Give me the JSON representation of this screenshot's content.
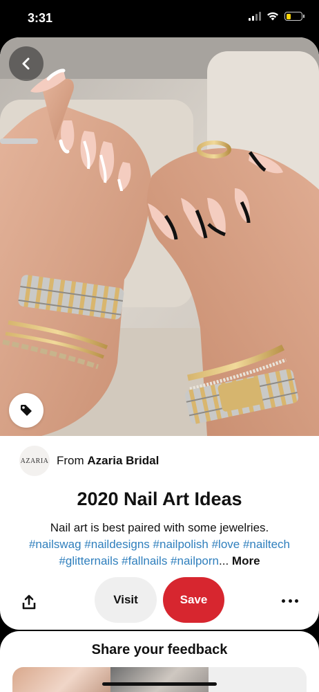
{
  "status": {
    "time": "3:31"
  },
  "pin": {
    "source_avatar_text": "AZARIA",
    "source_prefix": "From",
    "source_name": "Azaria Bridal",
    "title": "2020 Nail Art Ideas",
    "description_text": "Nail art is best paired with some jewelries.",
    "hashtags_line1": "#nailswag #naildesigns #nailpolish #love #nailtech",
    "hashtags_line2": "#glitternails #fallnails #nailporn",
    "ellipsis": "...",
    "more_label": "More"
  },
  "actions": {
    "visit_label": "Visit",
    "save_label": "Save"
  },
  "feedback": {
    "title": "Share your feedback"
  },
  "colors": {
    "save": "#d7262f",
    "hashtag": "#2f7fbd",
    "visit_bg": "#efefef"
  },
  "icons": [
    "back-chevron-icon",
    "tag-icon",
    "share-icon",
    "more-dots-icon",
    "wifi-icon",
    "signal-icon",
    "battery-icon"
  ]
}
